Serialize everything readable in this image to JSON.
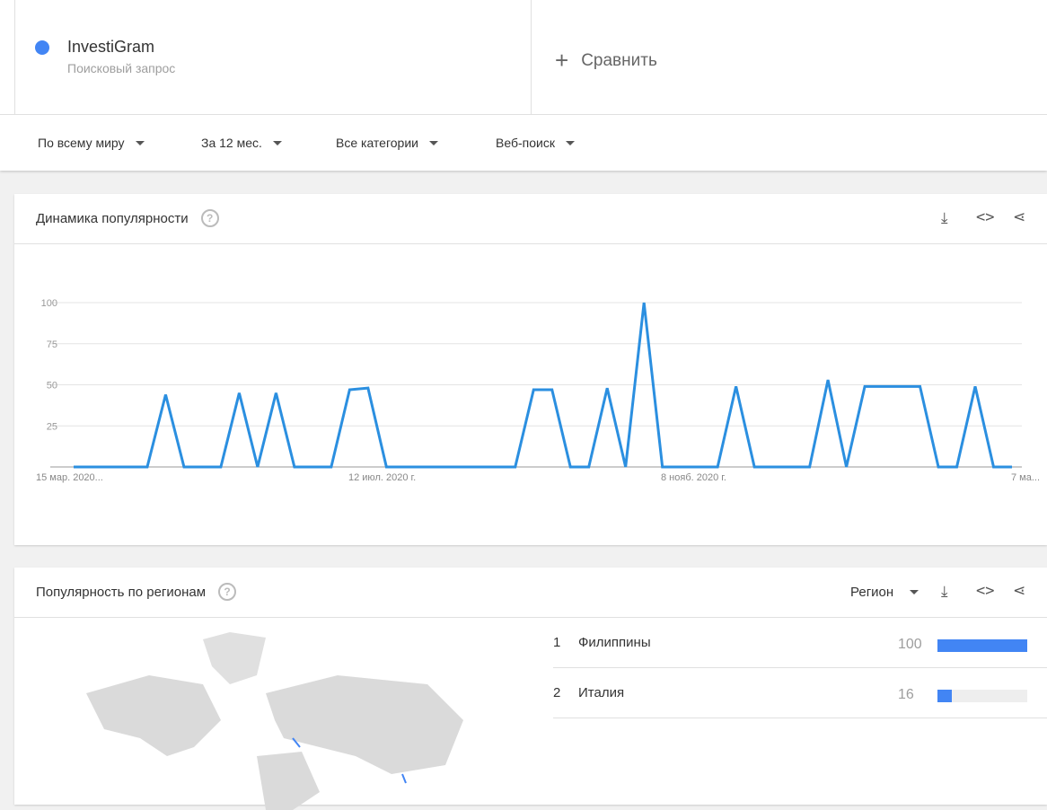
{
  "term": {
    "name": "InvestiGram",
    "subtitle": "Поисковый запрос",
    "color": "#4285f4"
  },
  "compare_label": "Сравнить",
  "filters": [
    "По всему миру",
    "За 12 мес.",
    "Все категории",
    "Веб-поиск"
  ],
  "interest": {
    "title": "Динамика популярности",
    "help": "?"
  },
  "chart_data": {
    "type": "line",
    "title": "Динамика популярности",
    "ylim": [
      0,
      100
    ],
    "yticks": [
      25,
      50,
      75,
      100
    ],
    "xtick_labels": [
      "15 мар. 2020...",
      "12 июл. 2020 г.",
      "8 нояб. 2020 г.",
      "7 ма..."
    ],
    "series": [
      {
        "name": "InvestiGram",
        "color": "#2b8fe0",
        "values": [
          0,
          0,
          0,
          0,
          0,
          44,
          0,
          0,
          0,
          45,
          0,
          45,
          0,
          0,
          0,
          47,
          48,
          0,
          0,
          0,
          0,
          0,
          0,
          0,
          0,
          47,
          47,
          0,
          0,
          48,
          0,
          100,
          0,
          0,
          0,
          0,
          49,
          0,
          0,
          0,
          0,
          53,
          0,
          49,
          49,
          49,
          49,
          0,
          0,
          49,
          0,
          0
        ]
      }
    ]
  },
  "regions": {
    "title": "Популярность по регионам",
    "help": "?",
    "dropdown": "Регион",
    "rows": [
      {
        "rank": "1",
        "name": "Филиппины",
        "value": "100",
        "fill": 100
      },
      {
        "rank": "2",
        "name": "Италия",
        "value": "16",
        "fill": 16
      }
    ]
  }
}
